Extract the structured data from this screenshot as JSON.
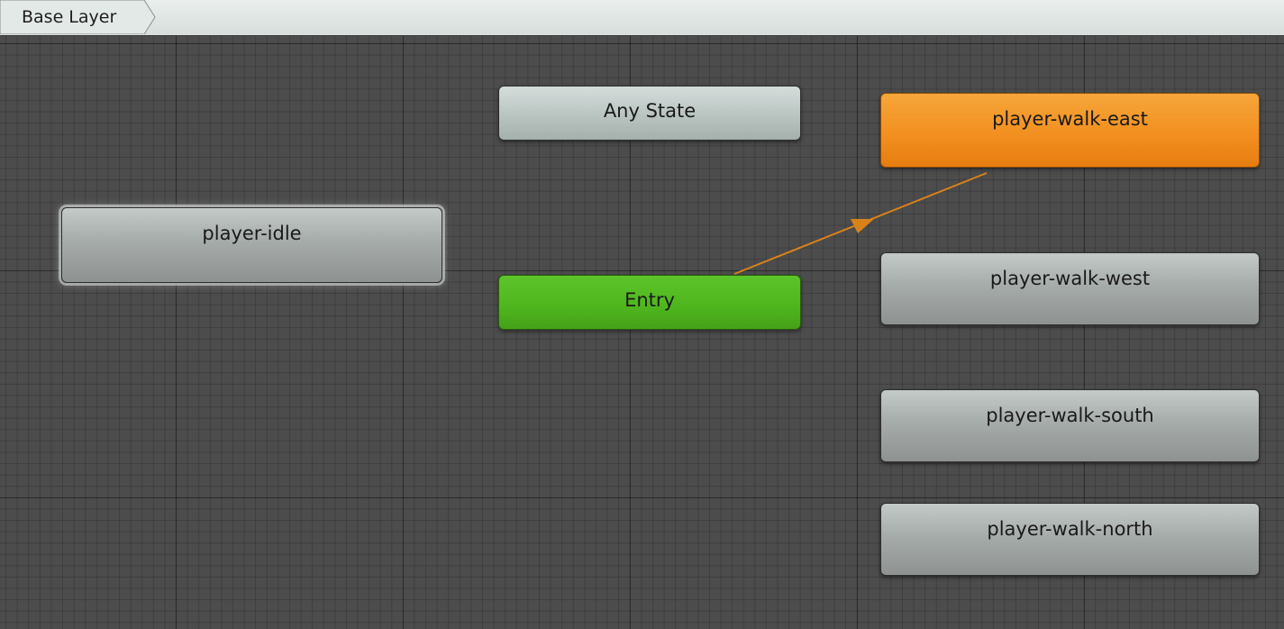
{
  "breadcrumb": {
    "layer_label": "Base Layer"
  },
  "states": {
    "any_state": "Any State",
    "entry": "Entry",
    "player_idle": "player-idle",
    "player_walk_east": "player-walk-east",
    "player_walk_west": "player-walk-west",
    "player_walk_south": "player-walk-south",
    "player_walk_north": "player-walk-north"
  },
  "colors": {
    "graph_background": "#4c4c4c",
    "entry_node": "#52b81f",
    "default_state_node": "#f29020",
    "state_node": "#a6acaa",
    "any_state_node": "#b9c4c1",
    "transition_arrow": "#d9821a"
  },
  "transitions": [
    {
      "from": "Entry",
      "to": "player-walk-east"
    }
  ]
}
